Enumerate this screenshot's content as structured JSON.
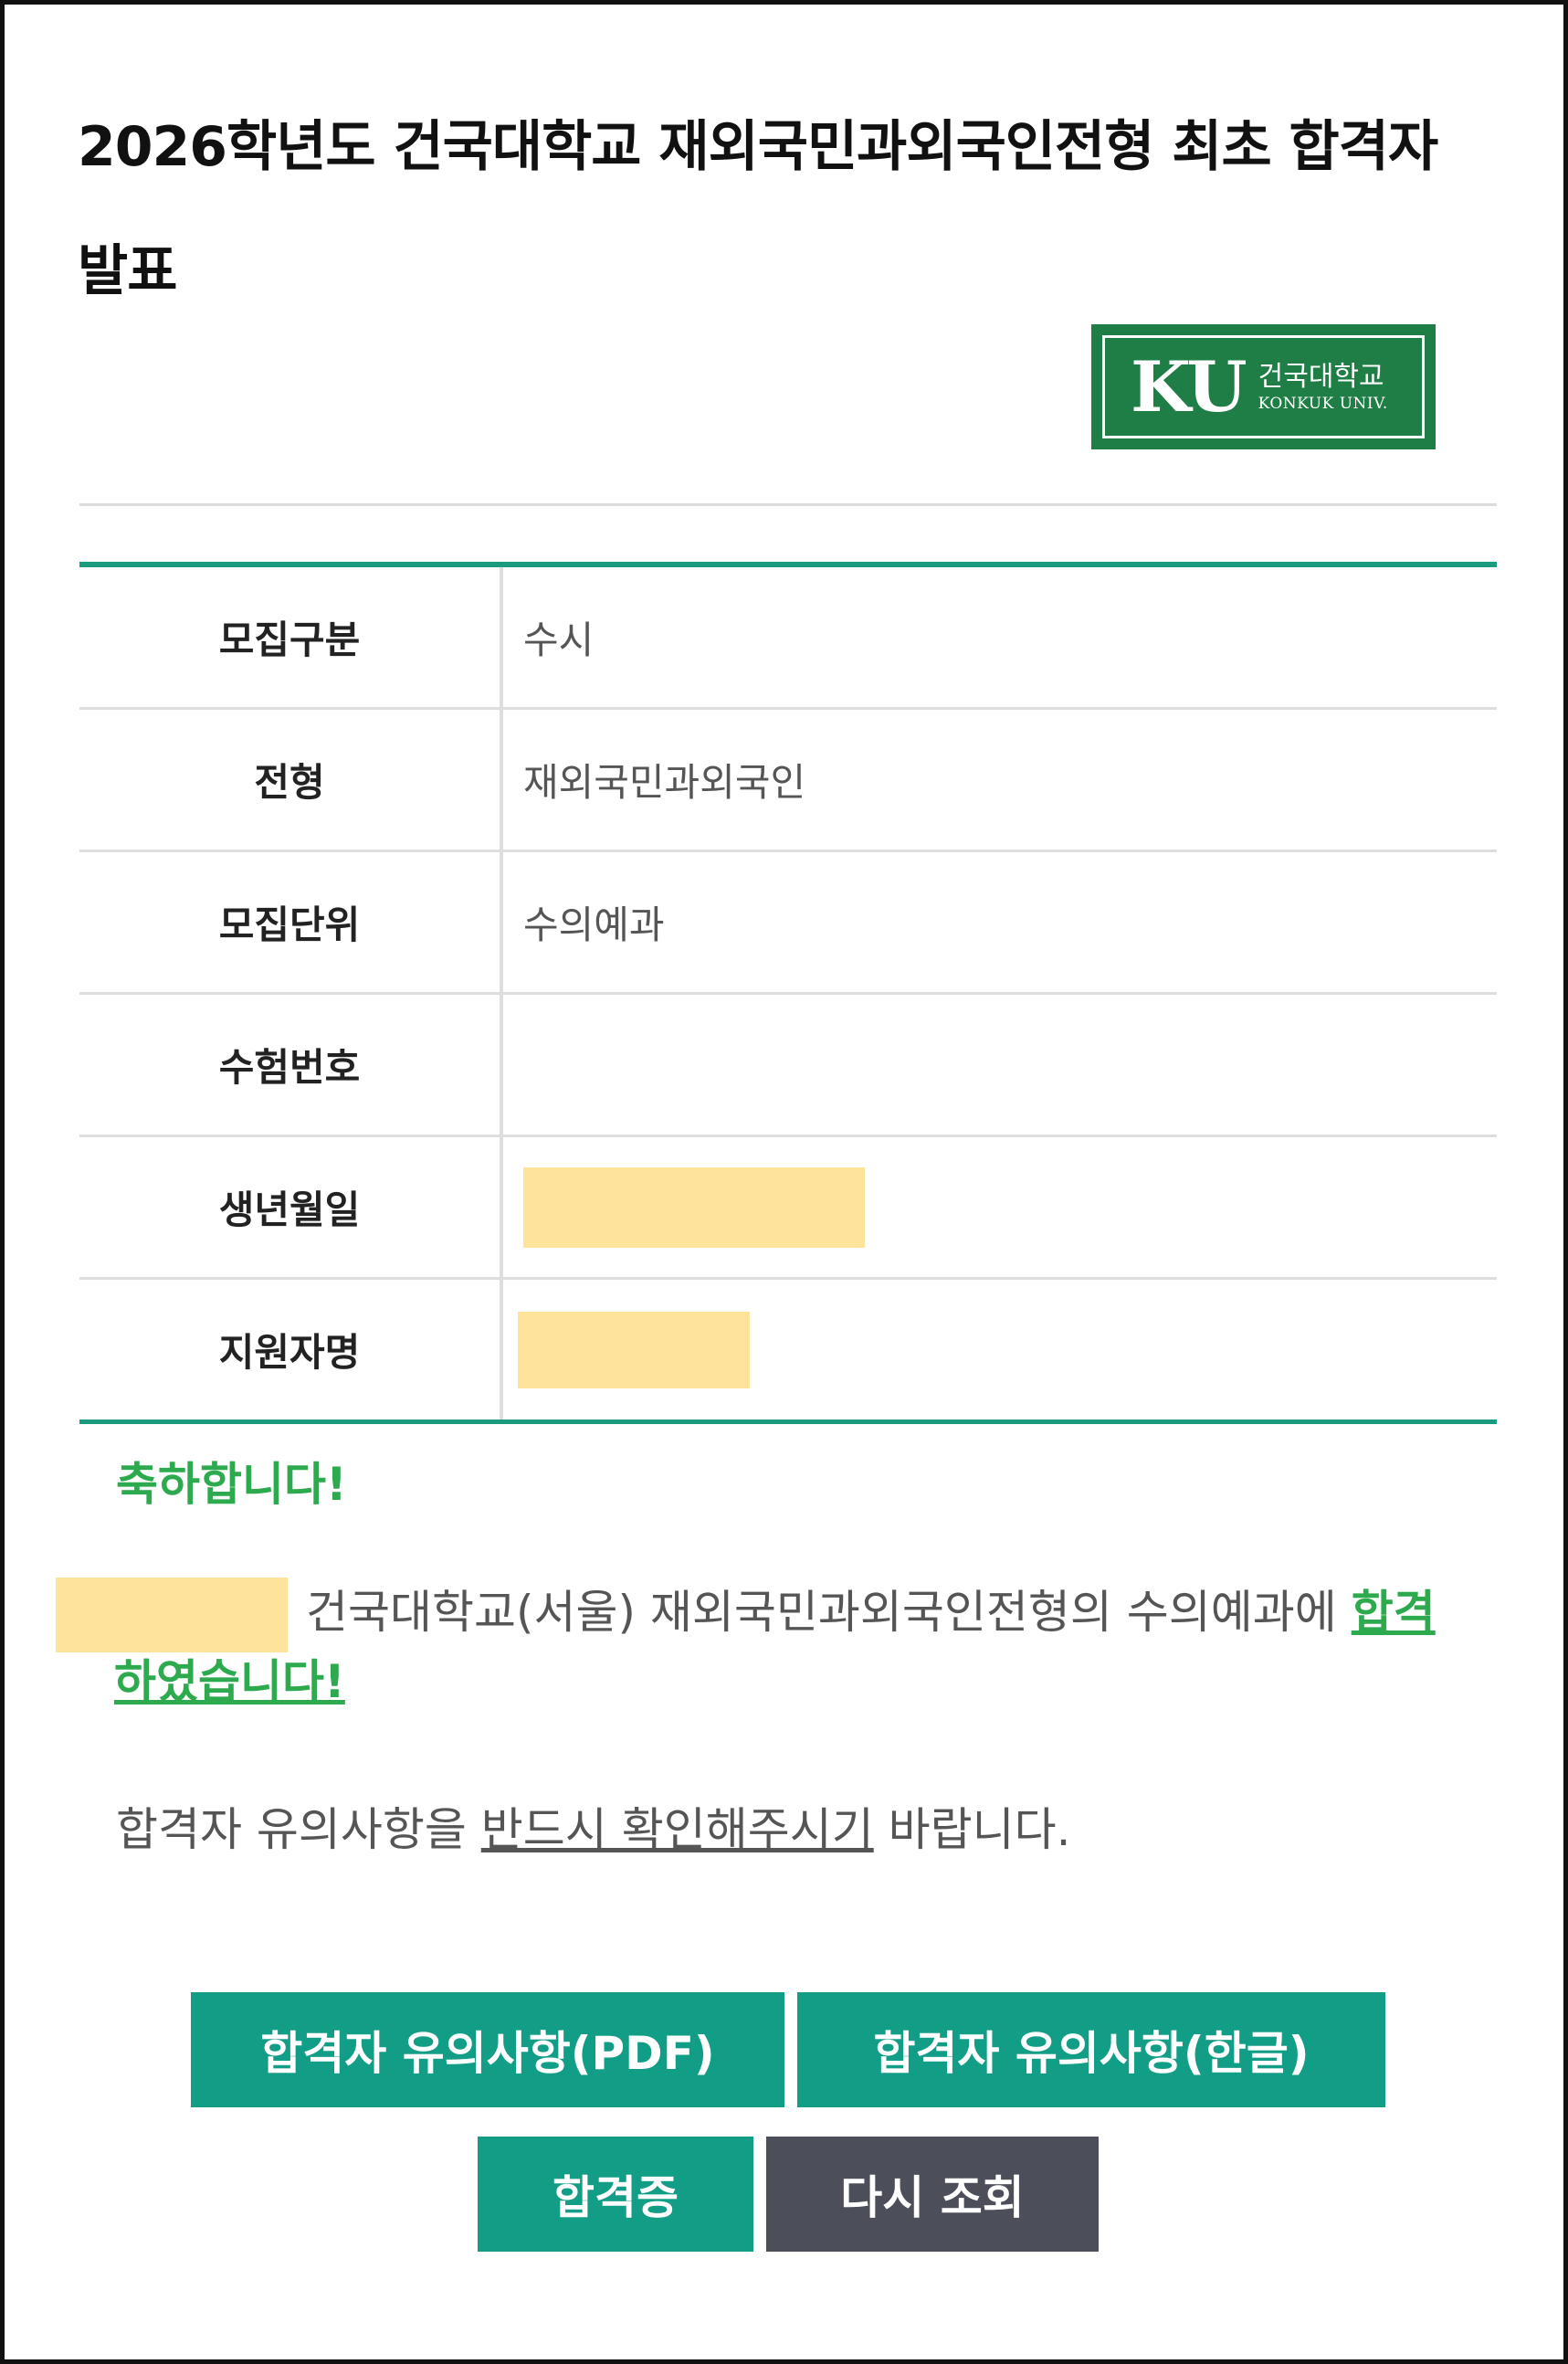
{
  "page": {
    "title": "2026학년도 건국대학교 재외국민과외국인전형 최초 합격자 발표"
  },
  "logo": {
    "mark": "KU",
    "name_kr": "건국대학교",
    "name_en": "KONKUK UNIV."
  },
  "info_table": {
    "rows": [
      {
        "label": "모집구분",
        "value": "수시"
      },
      {
        "label": "전형",
        "value": "재외국민과외국인"
      },
      {
        "label": "모집단위",
        "value": "수의예과"
      },
      {
        "label": "수험번호",
        "value": ""
      },
      {
        "label": "생년월일",
        "value": ""
      },
      {
        "label": "지원자명",
        "value": ""
      }
    ]
  },
  "result": {
    "congrats": "축하합니다!",
    "message": "건국대학교(서울) 재외국민과외국인전형의 수의예과에 ",
    "passed": "합격하였습니다!",
    "notice_before": "합격자 유의사항을 ",
    "notice_emphasis": "반드시 확인해주시기",
    "notice_after": " 바랍니다."
  },
  "buttons": {
    "notice_pdf": "합격자 유의사항(PDF)",
    "notice_hwp": "합격자 유의사항(한글)",
    "certificate": "합격증",
    "search_again": "다시 조회"
  },
  "colors": {
    "accent_teal": "#1a9a7f",
    "button_green": "#129d86",
    "button_gray": "#4c4e5a",
    "congrats_green": "#2eaa4e",
    "logo_green": "#1e7e45",
    "redaction": "#fee49b"
  }
}
